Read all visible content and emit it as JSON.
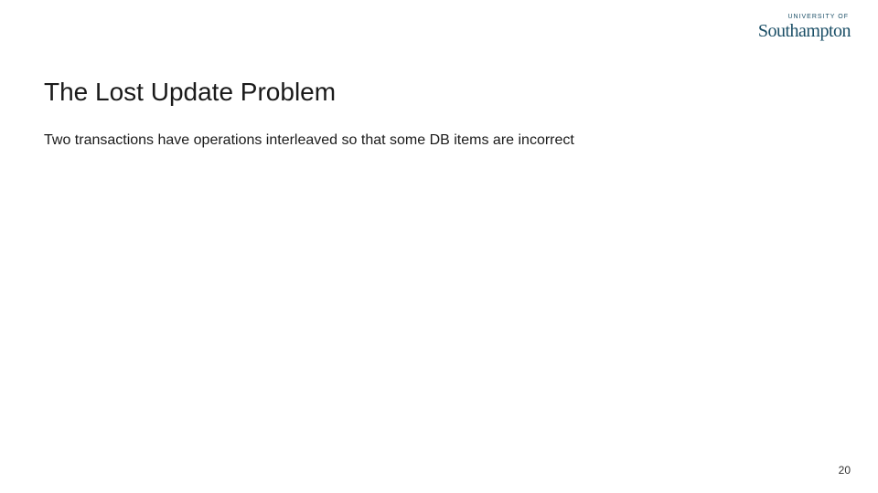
{
  "logo": {
    "top": "UNIVERSITY OF",
    "main": "Southampton"
  },
  "title": "The Lost Update Problem",
  "body": "Two transactions have operations interleaved so that some DB items are incorrect",
  "page_number": "20"
}
